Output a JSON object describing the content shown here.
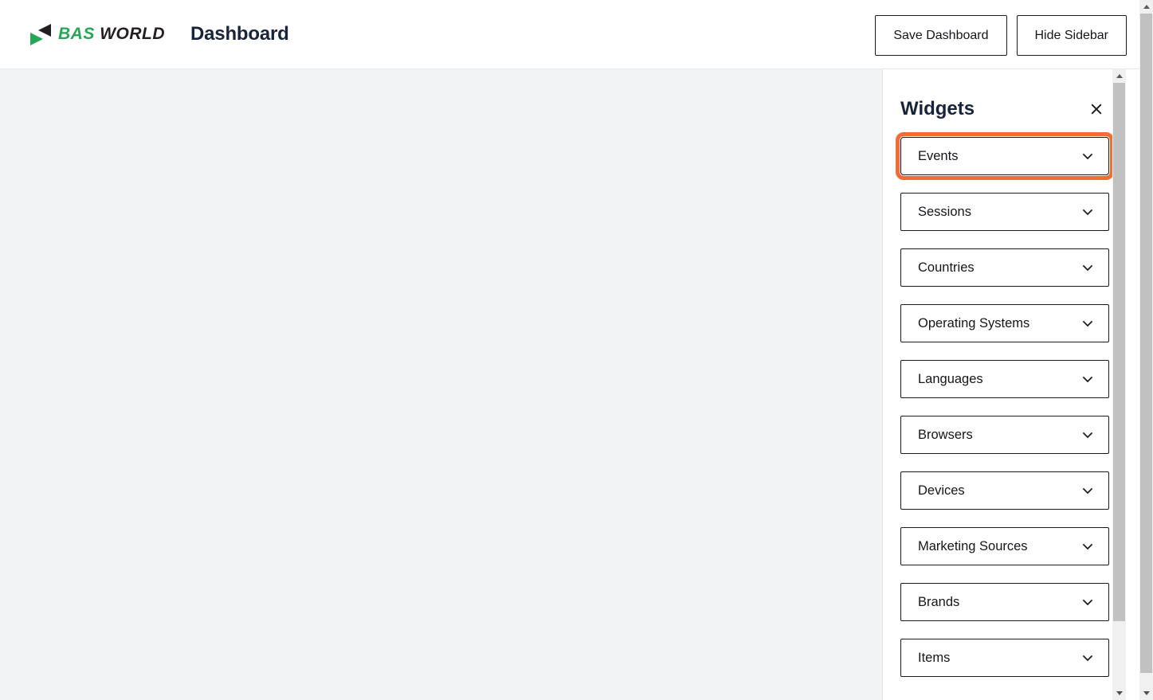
{
  "header": {
    "brand": {
      "mark_icon": "bas-world-logo-icon",
      "name_part1": "BAS",
      "name_part2": "WORLD"
    },
    "page_title": "Dashboard",
    "buttons": [
      {
        "label": "Save Dashboard",
        "name": "save-dashboard-button"
      },
      {
        "label": "Hide Sidebar",
        "name": "hide-sidebar-button"
      }
    ]
  },
  "sidebar": {
    "title": "Widgets",
    "close_icon": "close-icon",
    "highlight_color": "#f26c33",
    "highlighted_index": 0,
    "items": [
      {
        "label": "Events",
        "icon": "chevron-down-icon"
      },
      {
        "label": "Sessions",
        "icon": "chevron-down-icon"
      },
      {
        "label": "Countries",
        "icon": "chevron-down-icon"
      },
      {
        "label": "Operating Systems",
        "icon": "chevron-down-icon"
      },
      {
        "label": "Languages",
        "icon": "chevron-down-icon"
      },
      {
        "label": "Browsers",
        "icon": "chevron-down-icon"
      },
      {
        "label": "Devices",
        "icon": "chevron-down-icon"
      },
      {
        "label": "Marketing Sources",
        "icon": "chevron-down-icon"
      },
      {
        "label": "Brands",
        "icon": "chevron-down-icon"
      },
      {
        "label": "Items",
        "icon": "chevron-down-icon"
      }
    ]
  },
  "colors": {
    "brand_green": "#27a656",
    "brand_black": "#231f20",
    "title_navy": "#18243c",
    "canvas_bg": "#f2f3f5",
    "accent_orange": "#f26c33"
  }
}
